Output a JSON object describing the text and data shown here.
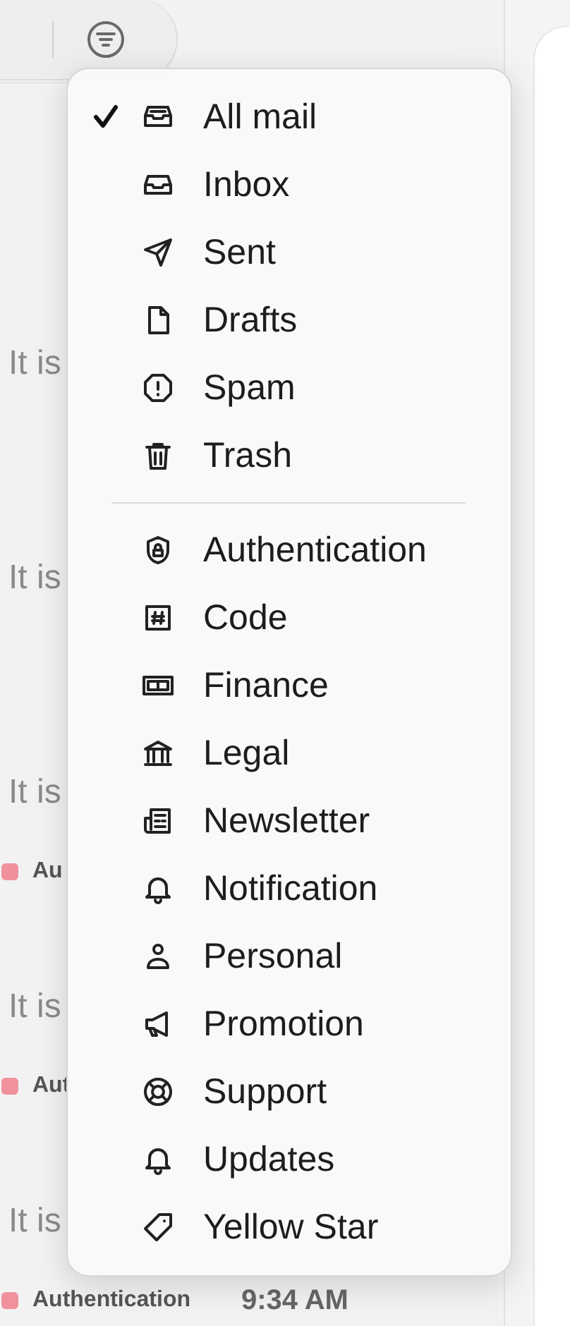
{
  "messages": [
    {
      "preview": "It is"
    },
    {
      "preview": "It is"
    },
    {
      "preview": "It is",
      "tag": {
        "label": "Au",
        "color": "#f0919d"
      }
    },
    {
      "preview": "It is",
      "tag": {
        "label": "Aut",
        "color": "#f0919d"
      }
    },
    {
      "preview": "It is",
      "tag": {
        "label": "Authentication",
        "color": "#f0919d"
      },
      "time": "9:34 AM"
    }
  ],
  "filter_menu": {
    "sections": [
      {
        "items": [
          {
            "label": "All mail",
            "selected": true
          },
          {
            "label": "Inbox",
            "selected": false
          },
          {
            "label": "Sent",
            "selected": false
          },
          {
            "label": "Drafts",
            "selected": false
          },
          {
            "label": "Spam",
            "selected": false
          },
          {
            "label": "Trash",
            "selected": false
          }
        ]
      },
      {
        "items": [
          {
            "label": "Authentication",
            "selected": false
          },
          {
            "label": "Code",
            "selected": false
          },
          {
            "label": "Finance",
            "selected": false
          },
          {
            "label": "Legal",
            "selected": false
          },
          {
            "label": "Newsletter",
            "selected": false
          },
          {
            "label": "Notification",
            "selected": false
          },
          {
            "label": "Personal",
            "selected": false
          },
          {
            "label": "Promotion",
            "selected": false
          },
          {
            "label": "Support",
            "selected": false
          },
          {
            "label": "Updates",
            "selected": false
          },
          {
            "label": "Yellow Star",
            "selected": false
          }
        ]
      }
    ]
  }
}
